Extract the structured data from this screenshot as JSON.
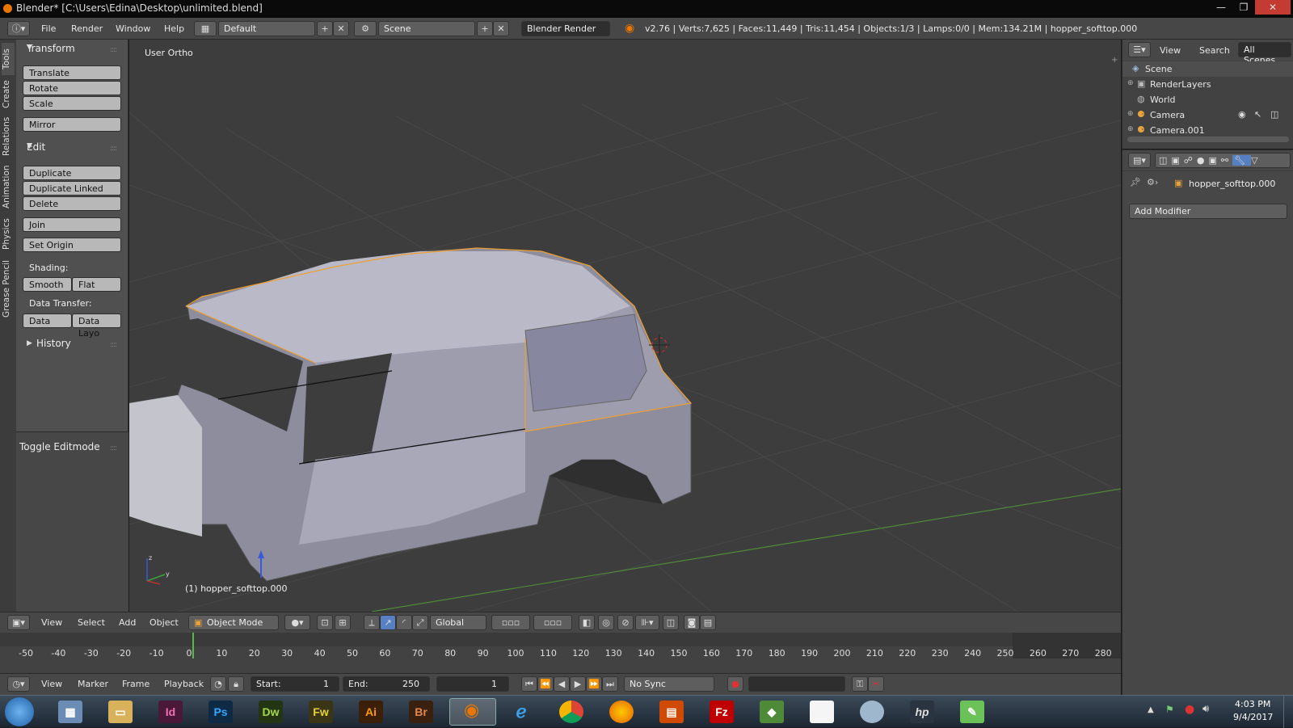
{
  "window": {
    "title": "Blender* [C:\\Users\\Edina\\Desktop\\unlimited.blend]",
    "minimize": "—",
    "maximize": "❐",
    "close": "✕"
  },
  "infobar": {
    "menus": [
      "File",
      "Render",
      "Window",
      "Help"
    ],
    "screen_layout": "Default",
    "scene": "Scene",
    "render_engine": "Blender Render",
    "stats": "v2.76 | Verts:7,625 | Faces:11,449 | Tris:11,454 | Objects:1/3 | Lamps:0/0 | Mem:134.21M | hopper_softtop.000"
  },
  "tool_tabs": [
    "Tools",
    "Create",
    "Relations",
    "Animation",
    "Physics",
    "Grease Pencil"
  ],
  "toolshelf": {
    "transform_title": "Transform",
    "translate": "Translate",
    "rotate": "Rotate",
    "scale": "Scale",
    "mirror": "Mirror",
    "edit_title": "Edit",
    "duplicate": "Duplicate",
    "duplicate_linked": "Duplicate Linked",
    "delete": "Delete",
    "join": "Join",
    "set_origin": "Set Origin",
    "shading_label": "Shading:",
    "smooth": "Smooth",
    "flat": "Flat",
    "data_transfer_label": "Data Transfer:",
    "data": "Data",
    "data_layout": "Data Layo",
    "history_title": "History",
    "toggle_editmode": "Toggle Editmode"
  },
  "viewport": {
    "view_label": "User Ortho",
    "object_label": "(1) hopper_softtop.000"
  },
  "view3d_header": {
    "menus": [
      "View",
      "Select",
      "Add",
      "Object"
    ],
    "mode": "Object Mode",
    "orientation": "Global"
  },
  "timeline": {
    "ticks": [
      "-50",
      "-40",
      "-30",
      "-20",
      "-10",
      "0",
      "10",
      "20",
      "30",
      "40",
      "50",
      "60",
      "70",
      "80",
      "90",
      "100",
      "110",
      "120",
      "130",
      "140",
      "150",
      "160",
      "170",
      "180",
      "190",
      "200",
      "210",
      "220",
      "230",
      "240",
      "250",
      "260",
      "270",
      "280"
    ],
    "current_frame_marker": 0
  },
  "timeline_header": {
    "menus": [
      "View",
      "Marker",
      "Frame",
      "Playback"
    ],
    "start_label": "Start:",
    "start_value": "1",
    "end_label": "End:",
    "end_value": "250",
    "current_frame": "1",
    "sync": "No Sync"
  },
  "outliner": {
    "header": [
      "View",
      "Search",
      "All Scenes"
    ],
    "items": [
      "Scene",
      "RenderLayers",
      "World",
      "Camera",
      "Camera.001"
    ]
  },
  "properties": {
    "object_name": "hopper_softtop.000",
    "add_modifier": "Add Modifier"
  },
  "taskbar": {
    "apps": [
      "Id",
      "Ps",
      "Dw",
      "Fw",
      "Ai",
      "Br",
      "Fz"
    ],
    "clock_time": "4:03 PM",
    "clock_date": "9/4/2017"
  },
  "colors": {
    "selected_outline": "#f0a030",
    "viewport_bg": "#3d3d3d",
    "panel_bg": "#505050",
    "accent_blue": "#5680c2"
  }
}
